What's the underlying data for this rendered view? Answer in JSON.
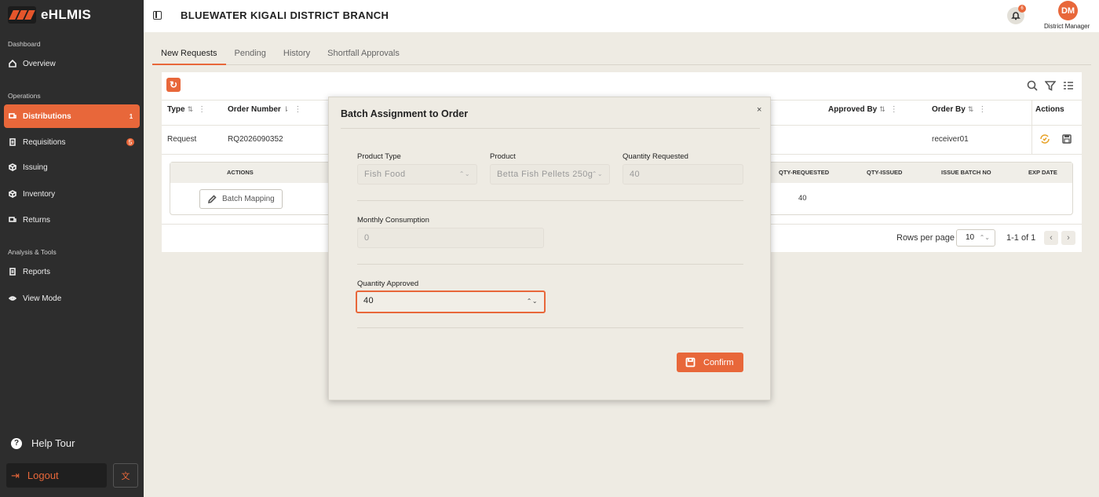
{
  "app": {
    "name": "eHLMIS"
  },
  "colors": {
    "accent": "#e8673a",
    "sidebar": "#2d2d2d"
  },
  "sidebar": {
    "sections": [
      "Dashboard",
      "Operations",
      "Analysis & Tools"
    ],
    "items": [
      {
        "label": "Overview",
        "icon": "home-icon"
      },
      {
        "label": "Distributions",
        "icon": "truck-icon",
        "badge": "1",
        "active": true
      },
      {
        "label": "Requisitions",
        "icon": "document-icon",
        "badge": "5"
      },
      {
        "label": "Issuing",
        "icon": "box-icon"
      },
      {
        "label": "Inventory",
        "icon": "inventory-icon"
      },
      {
        "label": "Returns",
        "icon": "return-icon"
      },
      {
        "label": "Reports",
        "icon": "report-icon"
      },
      {
        "label": "View Mode",
        "icon": "eye-icon"
      }
    ],
    "help_tour": "Help Tour",
    "logout": "Logout"
  },
  "header": {
    "title": "BLUEWATER KIGALI DISTRICT BRANCH",
    "notification_count": "6",
    "avatar_initials": "DM",
    "role": "District Manager"
  },
  "tabs": [
    "New Requests",
    "Pending",
    "History",
    "Shortfall Approvals"
  ],
  "table": {
    "columns": {
      "type": "Type",
      "order_number": "Order Number",
      "approved_by": "Approved By",
      "order_by": "Order By",
      "actions": "Actions"
    },
    "row": {
      "type": "Request",
      "order_number": "RQ2026090352",
      "order_by": "receiver01"
    },
    "sub_table": {
      "columns": {
        "actions": "ACTIONS",
        "qty_requested": "QTY-REQUESTED",
        "qty_issued": "QTY-ISSUED",
        "issue_batch_no": "ISSUE BATCH NO",
        "exp_date": "EXP DATE"
      },
      "batch_mapping": "Batch Mapping",
      "qty_requested_value": "40"
    },
    "pager": {
      "rows_per_page_label": "Rows per page",
      "rows_per_page": "10",
      "range": "1-1 of 1"
    }
  },
  "modal": {
    "title": "Batch Assignment to Order",
    "close": "×",
    "product_type": {
      "label": "Product Type",
      "value": "Fish Food"
    },
    "product": {
      "label": "Product",
      "value": "Betta Fish Pellets 250g"
    },
    "quantity_requested": {
      "label": "Quantity Requested",
      "value": "40"
    },
    "monthly_consumption": {
      "label": "Monthly Consumption",
      "value": "0"
    },
    "quantity_approved": {
      "label": "Quantity Approved",
      "value": "40"
    },
    "confirm": "Confirm"
  }
}
